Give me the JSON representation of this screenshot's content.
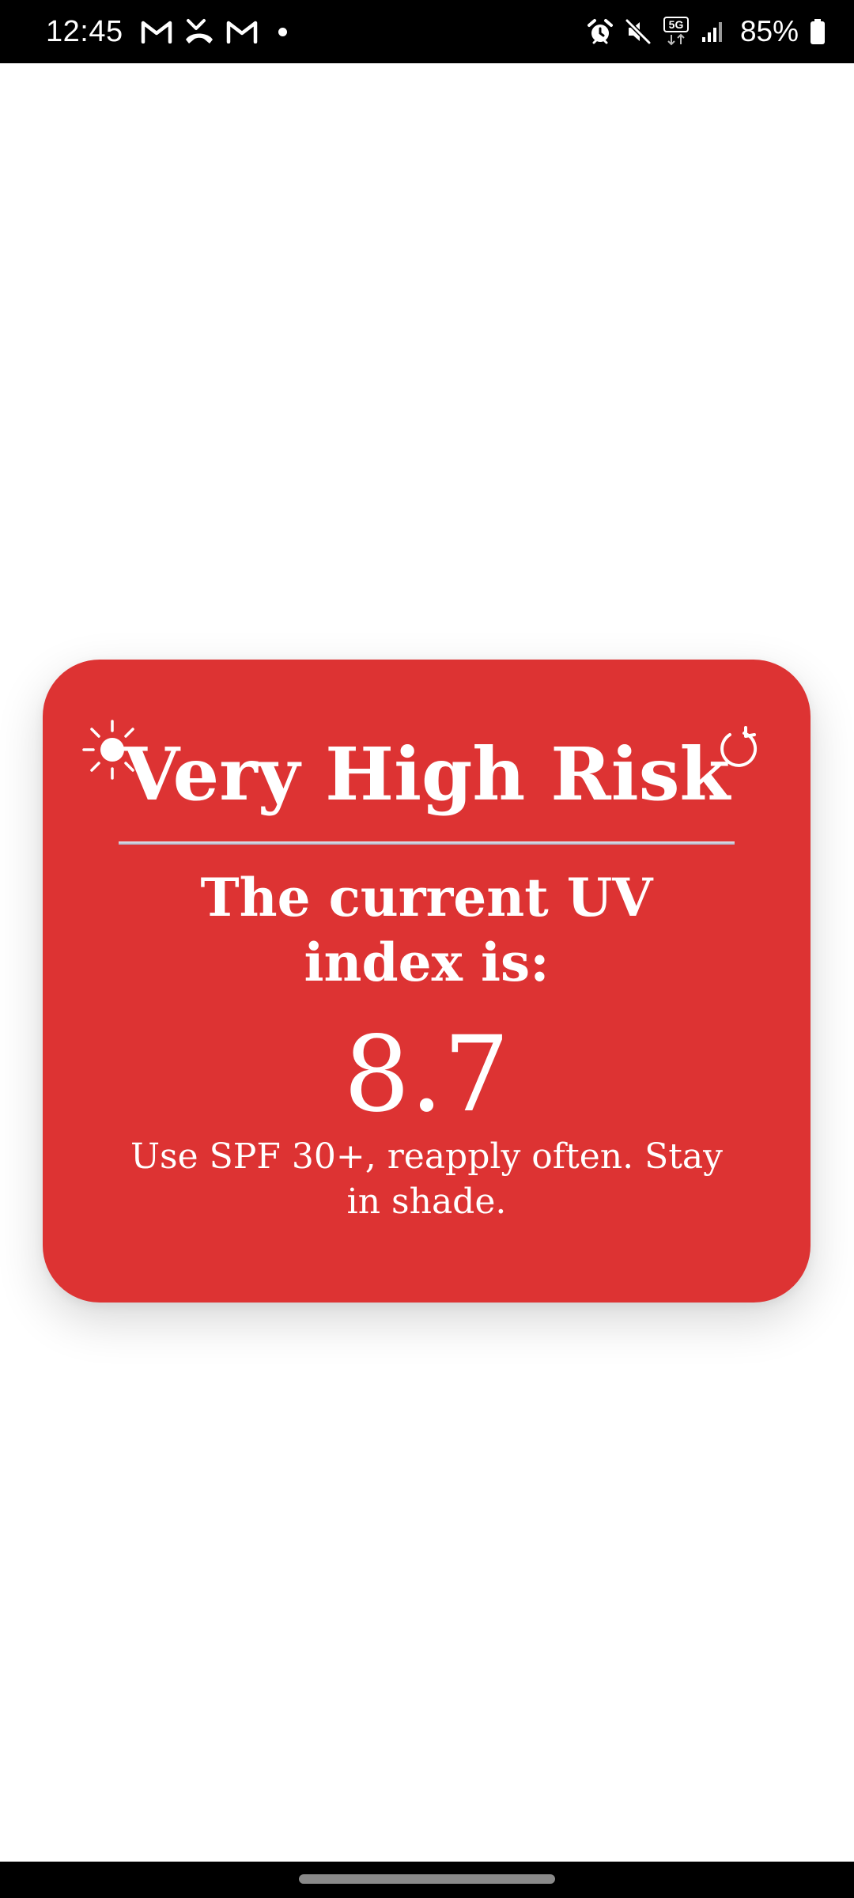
{
  "status_bar": {
    "time": "12:45",
    "left_icons": [
      "gmail-icon",
      "missed-call-icon",
      "gmail-icon",
      "notification-dot-icon"
    ],
    "right_icons": [
      "alarm-icon",
      "mute-icon",
      "5g-icon",
      "signal-icon",
      "battery-icon"
    ],
    "network_label": "5G",
    "battery_percent": "85%"
  },
  "card": {
    "risk_title": "Very High Risk",
    "heading": "The current UV index is:",
    "uv_value": "8.7",
    "advice": "Use SPF 30+, reapply often. Stay in shade.",
    "background_color": "#dd3333",
    "text_color": "#ffffff",
    "left_icon": "sun-icon",
    "right_icon": "refresh-icon"
  },
  "nav": {
    "home_handle": "home-handle"
  }
}
